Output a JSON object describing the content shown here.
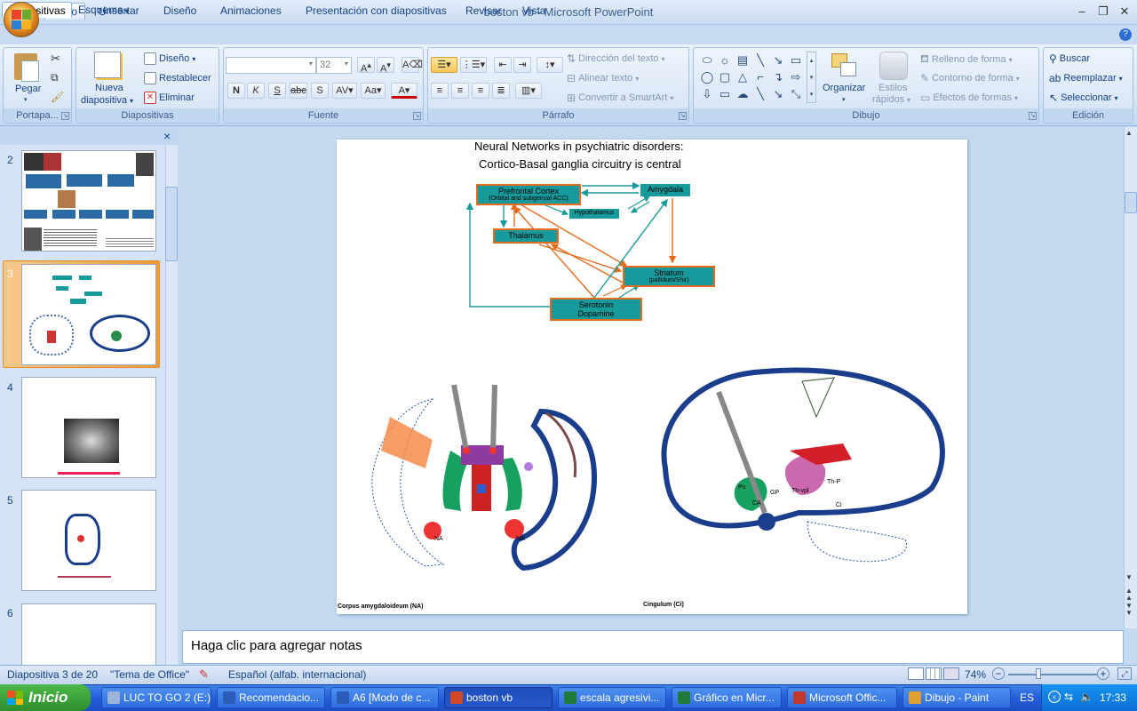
{
  "app": {
    "title": "boston vb - Microsoft PowerPoint",
    "window_controls": {
      "min": "‒",
      "restore": "❐",
      "close": "✕"
    }
  },
  "quick_access": {
    "save_icon": "save-icon",
    "undo_icon": "undo-icon",
    "redo_icon": "redo-icon"
  },
  "tabs": [
    {
      "label": "Inicio",
      "active": true
    },
    {
      "label": "Insertar"
    },
    {
      "label": "Diseño"
    },
    {
      "label": "Animaciones"
    },
    {
      "label": "Presentación con diapositivas"
    },
    {
      "label": "Revisar"
    },
    {
      "label": "Vista"
    }
  ],
  "ribbon": {
    "portapapeles": {
      "label": "Portapa...",
      "pegar": "Pegar"
    },
    "diapositivas": {
      "label": "Diapositivas",
      "nueva": "Nueva",
      "diapositiva": "diapositiva",
      "diseno": "Diseño",
      "restablecer": "Restablecer",
      "eliminar": "Eliminar"
    },
    "fuente": {
      "label": "Fuente",
      "font_size": "32"
    },
    "parrafo": {
      "label": "Párrafo",
      "direccion": "Dirección del texto",
      "alinear": "Alinear texto",
      "convertir": "Convertir a SmartArt"
    },
    "dibujo": {
      "label": "Dibujo",
      "organizar": "Organizar",
      "estilos": "Estilos",
      "rapidos": "rápidos",
      "relleno": "Relleno de forma",
      "contorno": "Contorno de forma",
      "efectos": "Efectos de formas"
    },
    "edicion": {
      "label": "Edición",
      "buscar": "Buscar",
      "reemplazar": "Reemplazar",
      "seleccionar": "Seleccionar"
    }
  },
  "left_pane": {
    "tabs": [
      "Diapositivas",
      "Esquema"
    ],
    "close": "×",
    "slides": [
      {
        "number": "2"
      },
      {
        "number": "3",
        "selected": true
      },
      {
        "number": "4"
      },
      {
        "number": "5"
      },
      {
        "number": "6"
      }
    ]
  },
  "slide": {
    "title1": "Neural Networks in psychiatric disorders:",
    "title2": "Cortico-Basal ganglia circuitry is central",
    "boxes": {
      "pfc": "Prefrontal Cortex",
      "pfc_sub": "(Orbital and subgenual ACC)",
      "amygdala": "Amygdala",
      "hypothalamus": "Hypothalamus",
      "thalamus": "Thalamus",
      "striatum": "Striatum",
      "striatum_sub": "(pallidum/Shir)",
      "serotonin": "Serotonin",
      "dopamine": "Dopamine"
    },
    "brain_labels": {
      "na_left": "NA",
      "na_right": "NA",
      "thp": "Th-P",
      "thvpl": "Th-vpl",
      "gp": "GP",
      "ca": "CA",
      "ci": "Ci",
      "put": "Pu"
    },
    "caption_left": "Corpus amygdaloideum  (NA)",
    "caption_right": "Cingulum  (Ci)"
  },
  "notes": {
    "placeholder": "Haga clic para agregar notas"
  },
  "status": {
    "slide_count": "Diapositiva 3 de 20",
    "theme": "\"Tema de Office\"",
    "language": "Español (alfab. internacional)",
    "zoom": "74%"
  },
  "taskbar": {
    "start": "Inicio",
    "items": [
      {
        "label": "LUC TO GO 2 (E:)",
        "color": "#9bb4d8"
      },
      {
        "label": "Recomendacio...",
        "color": "#2b5cb8"
      },
      {
        "label": "A6 [Modo de c...",
        "color": "#2b5cb8"
      },
      {
        "label": "boston vb",
        "color": "#d24726",
        "active": true
      },
      {
        "label": "escala agresivi...",
        "color": "#1f7a3a"
      },
      {
        "label": "Gráfico en Micr...",
        "color": "#1f7a3a"
      },
      {
        "label": "Microsoft Offic...",
        "color": "#c0392b"
      },
      {
        "label": "Dibujo - Paint",
        "color": "#e0a030"
      }
    ],
    "lang": "ES",
    "time": "17:33"
  },
  "colors": {
    "accent": "#15428b",
    "teal": "#179a9c",
    "orange": "#e36c1f",
    "selection": "#f5b35b"
  }
}
